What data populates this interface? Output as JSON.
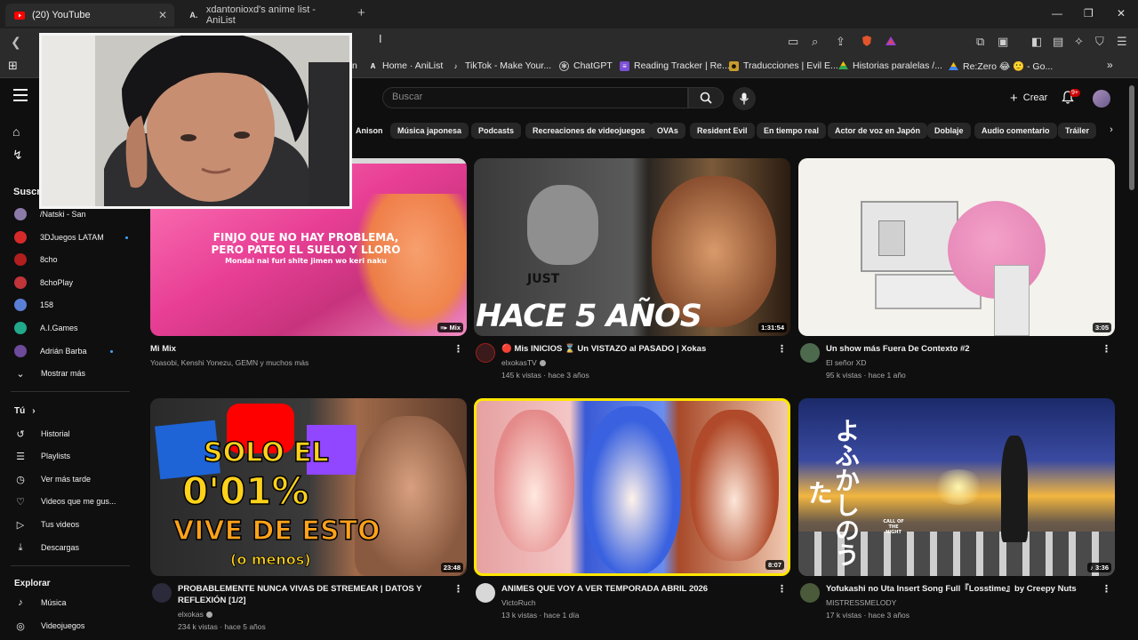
{
  "browser": {
    "tabs": [
      {
        "title": "(20) YouTube",
        "active": true
      },
      {
        "title": "xdantonioxd's anime list - AniList",
        "active": false
      }
    ],
    "bookmarks": [
      {
        "label": "Home · AniList",
        "icon": "anilist-icon"
      },
      {
        "label": "TikTok - Make Your...",
        "icon": "tiktok-icon"
      },
      {
        "label": "ChatGPT",
        "icon": "chatgpt-icon"
      },
      {
        "label": "Reading Tracker | Re...",
        "icon": "reading-tracker-icon"
      },
      {
        "label": "Traducciones | Evil E...",
        "icon": "translations-icon"
      },
      {
        "label": "Historias paralelas /...",
        "icon": "drive-icon"
      },
      {
        "label": "Re:Zero 😂 🙂 - Go...",
        "icon": "drive-icon"
      }
    ],
    "bookmark_partial": "n"
  },
  "youtube": {
    "search_placeholder": "Buscar",
    "create_label": "Crear",
    "notification_count": "9+",
    "chips": [
      "Anison",
      "Música japonesa",
      "Podcasts",
      "Recreaciones de videojuegos",
      "OVAs",
      "Resident Evil",
      "En tiempo real",
      "Actor de voz en Japón",
      "Doblaje",
      "Audio comentario",
      "Tráiler"
    ],
    "sidebar": {
      "subscriptions_heading": "Suscri",
      "subscriptions": [
        {
          "name": "/Natski - San",
          "color": "#8c7aa8",
          "dot": false
        },
        {
          "name": "3DJuegos LATAM",
          "color": "#d62a2a",
          "dot": true
        },
        {
          "name": "8cho",
          "color": "#b01e1e",
          "dot": false
        },
        {
          "name": "8choPlay",
          "color": "#c0343a",
          "dot": false
        },
        {
          "name": "158",
          "color": "#5a7fd6",
          "dot": false
        },
        {
          "name": "A.I.Games",
          "color": "#22a88a",
          "dot": false
        },
        {
          "name": "Adrián Barba",
          "color": "#6d4a9a",
          "dot": true
        }
      ],
      "show_more": "Mostrar más",
      "you_heading": "Tú",
      "you_items": [
        {
          "label": "Historial",
          "icon": "history-icon",
          "glyph": "↺"
        },
        {
          "label": "Playlists",
          "icon": "playlists-icon",
          "glyph": "☰"
        },
        {
          "label": "Ver más tarde",
          "icon": "watch-later-icon",
          "glyph": "◷"
        },
        {
          "label": "Videos que me gus...",
          "icon": "like-icon",
          "glyph": "👍"
        },
        {
          "label": "Tus videos",
          "icon": "your-videos-icon",
          "glyph": "▶"
        },
        {
          "label": "Descargas",
          "icon": "download-icon",
          "glyph": "⤓"
        }
      ],
      "explore_heading": "Explorar",
      "explore_items": [
        {
          "label": "Música",
          "icon": "music-icon",
          "glyph": "♪"
        },
        {
          "label": "Videojuegos",
          "icon": "gaming-icon",
          "glyph": "🎮"
        }
      ]
    },
    "videos": [
      {
        "title": "Mi Mix",
        "channel": "Yoasobi, Kenshi Yonezu, GEMN y muchos más",
        "stats": "",
        "duration": "Mix",
        "thumb_line1": "FINJO QUE NO HAY PROBLEMA,",
        "thumb_line2": "PERO PATEO EL SUELO Y LLORO",
        "thumb_line3": "Mondai nai furi shite jimen wo keri naku"
      },
      {
        "title": "🔴 Mis INICIOS ⌛ Un VISTAZO al PASADO | Xokas",
        "channel": "elxokasTV",
        "stats": "145 k vistas · hace 3 años",
        "duration": "1:31:54",
        "thumb_line1": "HACE 5 AÑOS",
        "thumb_line2": "JUST"
      },
      {
        "title": "Un show más Fuera De Contexto #2",
        "channel": "El señor XD",
        "stats": "95 k vistas · hace 1 año",
        "duration": "3:05"
      },
      {
        "title": "PROBABLEMENTE NUNCA VIVAS DE STREMEAR | DATOS Y REFLEXIÓN [1/2]",
        "channel": "elxokas",
        "stats": "234 k vistas · hace 5 años",
        "duration": "23:48",
        "thumb_line1": "SOLO EL",
        "thumb_line2": "0'01%",
        "thumb_line3": "VIVE DE ESTO",
        "thumb_line4": "(o menos)"
      },
      {
        "title": "ANIMES QUE VOY A VER TEMPORADA ABRIL 2026",
        "channel": "VictoRuch",
        "stats": "13 k vistas · hace 1 día",
        "duration": "8:07"
      },
      {
        "title": "Yofukashi no Uta Insert Song Full『Losstime』by Creepy Nuts",
        "channel": "MISTRESSMELODY",
        "stats": "17 k vistas · hace 3 años",
        "duration": "3:36",
        "thumb_line1": "よふかしのうた",
        "thumb_line2": "CALL OF THE NIGHT"
      }
    ]
  }
}
